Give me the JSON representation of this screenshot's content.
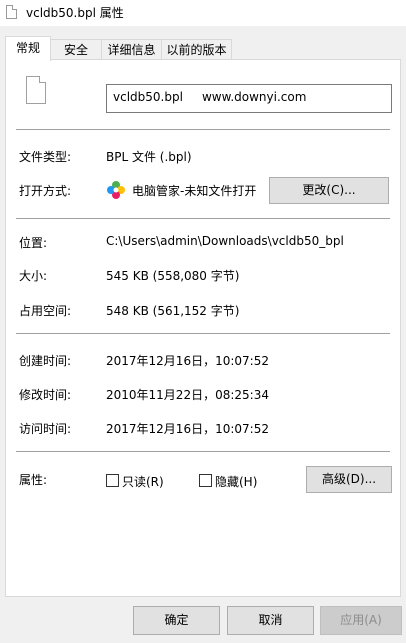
{
  "window": {
    "title": "vcldb50.bpl 属性"
  },
  "tabs": [
    {
      "label": "常规"
    },
    {
      "label": "安全"
    },
    {
      "label": "详细信息"
    },
    {
      "label": "以前的版本"
    }
  ],
  "general": {
    "file_name": "vcldb50.bpl     www.downyi.com",
    "file_type_label": "文件类型:",
    "file_type_value": "BPL 文件 (.bpl)",
    "opens_with_label": "打开方式:",
    "opens_with_value": "电脑管家-未知文件打开",
    "change_button": "更改(C)...",
    "location_label": "位置:",
    "location_value": "C:\\Users\\admin\\Downloads\\vcldb50_bpl",
    "size_label": "大小:",
    "size_value": "545 KB (558,080 字节)",
    "size_on_disk_label": "占用空间:",
    "size_on_disk_value": "548 KB (561,152 字节)",
    "created_label": "创建时间:",
    "created_value": "2017年12月16日，10:07:52",
    "modified_label": "修改时间:",
    "modified_value": "2010年11月22日，08:25:34",
    "accessed_label": "访问时间:",
    "accessed_value": "2017年12月16日，10:07:52",
    "attributes_label": "属性:",
    "readonly_label": "只读(R)",
    "hidden_label": "隐藏(H)",
    "advanced_button": "高级(D)..."
  },
  "footer": {
    "ok_button": "确定",
    "cancel_button": "取消",
    "apply_button": "应用(A)"
  }
}
